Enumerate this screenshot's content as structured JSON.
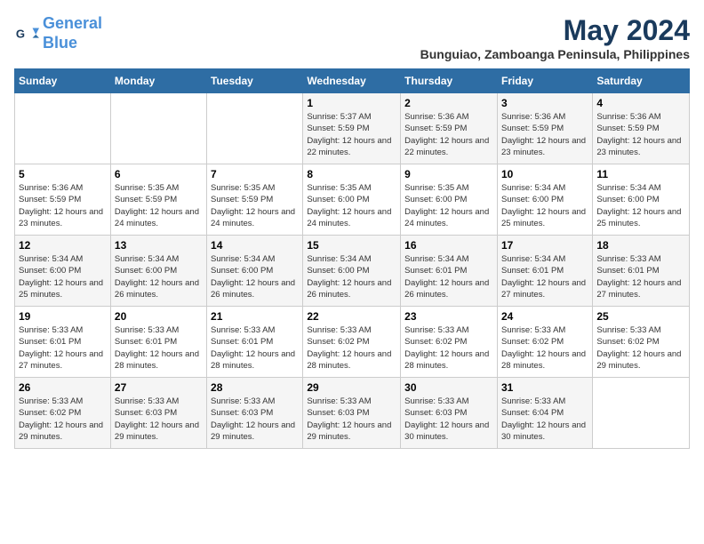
{
  "logo": {
    "line1": "General",
    "line2": "Blue"
  },
  "title": {
    "month_year": "May 2024",
    "location": "Bunguiao, Zamboanga Peninsula, Philippines"
  },
  "days_of_week": [
    "Sunday",
    "Monday",
    "Tuesday",
    "Wednesday",
    "Thursday",
    "Friday",
    "Saturday"
  ],
  "weeks": [
    {
      "days": [
        {
          "num": "",
          "sunrise": "",
          "sunset": "",
          "daylight": ""
        },
        {
          "num": "",
          "sunrise": "",
          "sunset": "",
          "daylight": ""
        },
        {
          "num": "",
          "sunrise": "",
          "sunset": "",
          "daylight": ""
        },
        {
          "num": "1",
          "sunrise": "Sunrise: 5:37 AM",
          "sunset": "Sunset: 5:59 PM",
          "daylight": "Daylight: 12 hours and 22 minutes."
        },
        {
          "num": "2",
          "sunrise": "Sunrise: 5:36 AM",
          "sunset": "Sunset: 5:59 PM",
          "daylight": "Daylight: 12 hours and 22 minutes."
        },
        {
          "num": "3",
          "sunrise": "Sunrise: 5:36 AM",
          "sunset": "Sunset: 5:59 PM",
          "daylight": "Daylight: 12 hours and 23 minutes."
        },
        {
          "num": "4",
          "sunrise": "Sunrise: 5:36 AM",
          "sunset": "Sunset: 5:59 PM",
          "daylight": "Daylight: 12 hours and 23 minutes."
        }
      ]
    },
    {
      "days": [
        {
          "num": "5",
          "sunrise": "Sunrise: 5:36 AM",
          "sunset": "Sunset: 5:59 PM",
          "daylight": "Daylight: 12 hours and 23 minutes."
        },
        {
          "num": "6",
          "sunrise": "Sunrise: 5:35 AM",
          "sunset": "Sunset: 5:59 PM",
          "daylight": "Daylight: 12 hours and 24 minutes."
        },
        {
          "num": "7",
          "sunrise": "Sunrise: 5:35 AM",
          "sunset": "Sunset: 5:59 PM",
          "daylight": "Daylight: 12 hours and 24 minutes."
        },
        {
          "num": "8",
          "sunrise": "Sunrise: 5:35 AM",
          "sunset": "Sunset: 6:00 PM",
          "daylight": "Daylight: 12 hours and 24 minutes."
        },
        {
          "num": "9",
          "sunrise": "Sunrise: 5:35 AM",
          "sunset": "Sunset: 6:00 PM",
          "daylight": "Daylight: 12 hours and 24 minutes."
        },
        {
          "num": "10",
          "sunrise": "Sunrise: 5:34 AM",
          "sunset": "Sunset: 6:00 PM",
          "daylight": "Daylight: 12 hours and 25 minutes."
        },
        {
          "num": "11",
          "sunrise": "Sunrise: 5:34 AM",
          "sunset": "Sunset: 6:00 PM",
          "daylight": "Daylight: 12 hours and 25 minutes."
        }
      ]
    },
    {
      "days": [
        {
          "num": "12",
          "sunrise": "Sunrise: 5:34 AM",
          "sunset": "Sunset: 6:00 PM",
          "daylight": "Daylight: 12 hours and 25 minutes."
        },
        {
          "num": "13",
          "sunrise": "Sunrise: 5:34 AM",
          "sunset": "Sunset: 6:00 PM",
          "daylight": "Daylight: 12 hours and 26 minutes."
        },
        {
          "num": "14",
          "sunrise": "Sunrise: 5:34 AM",
          "sunset": "Sunset: 6:00 PM",
          "daylight": "Daylight: 12 hours and 26 minutes."
        },
        {
          "num": "15",
          "sunrise": "Sunrise: 5:34 AM",
          "sunset": "Sunset: 6:00 PM",
          "daylight": "Daylight: 12 hours and 26 minutes."
        },
        {
          "num": "16",
          "sunrise": "Sunrise: 5:34 AM",
          "sunset": "Sunset: 6:01 PM",
          "daylight": "Daylight: 12 hours and 26 minutes."
        },
        {
          "num": "17",
          "sunrise": "Sunrise: 5:34 AM",
          "sunset": "Sunset: 6:01 PM",
          "daylight": "Daylight: 12 hours and 27 minutes."
        },
        {
          "num": "18",
          "sunrise": "Sunrise: 5:33 AM",
          "sunset": "Sunset: 6:01 PM",
          "daylight": "Daylight: 12 hours and 27 minutes."
        }
      ]
    },
    {
      "days": [
        {
          "num": "19",
          "sunrise": "Sunrise: 5:33 AM",
          "sunset": "Sunset: 6:01 PM",
          "daylight": "Daylight: 12 hours and 27 minutes."
        },
        {
          "num": "20",
          "sunrise": "Sunrise: 5:33 AM",
          "sunset": "Sunset: 6:01 PM",
          "daylight": "Daylight: 12 hours and 28 minutes."
        },
        {
          "num": "21",
          "sunrise": "Sunrise: 5:33 AM",
          "sunset": "Sunset: 6:01 PM",
          "daylight": "Daylight: 12 hours and 28 minutes."
        },
        {
          "num": "22",
          "sunrise": "Sunrise: 5:33 AM",
          "sunset": "Sunset: 6:02 PM",
          "daylight": "Daylight: 12 hours and 28 minutes."
        },
        {
          "num": "23",
          "sunrise": "Sunrise: 5:33 AM",
          "sunset": "Sunset: 6:02 PM",
          "daylight": "Daylight: 12 hours and 28 minutes."
        },
        {
          "num": "24",
          "sunrise": "Sunrise: 5:33 AM",
          "sunset": "Sunset: 6:02 PM",
          "daylight": "Daylight: 12 hours and 28 minutes."
        },
        {
          "num": "25",
          "sunrise": "Sunrise: 5:33 AM",
          "sunset": "Sunset: 6:02 PM",
          "daylight": "Daylight: 12 hours and 29 minutes."
        }
      ]
    },
    {
      "days": [
        {
          "num": "26",
          "sunrise": "Sunrise: 5:33 AM",
          "sunset": "Sunset: 6:02 PM",
          "daylight": "Daylight: 12 hours and 29 minutes."
        },
        {
          "num": "27",
          "sunrise": "Sunrise: 5:33 AM",
          "sunset": "Sunset: 6:03 PM",
          "daylight": "Daylight: 12 hours and 29 minutes."
        },
        {
          "num": "28",
          "sunrise": "Sunrise: 5:33 AM",
          "sunset": "Sunset: 6:03 PM",
          "daylight": "Daylight: 12 hours and 29 minutes."
        },
        {
          "num": "29",
          "sunrise": "Sunrise: 5:33 AM",
          "sunset": "Sunset: 6:03 PM",
          "daylight": "Daylight: 12 hours and 29 minutes."
        },
        {
          "num": "30",
          "sunrise": "Sunrise: 5:33 AM",
          "sunset": "Sunset: 6:03 PM",
          "daylight": "Daylight: 12 hours and 30 minutes."
        },
        {
          "num": "31",
          "sunrise": "Sunrise: 5:33 AM",
          "sunset": "Sunset: 6:04 PM",
          "daylight": "Daylight: 12 hours and 30 minutes."
        },
        {
          "num": "",
          "sunrise": "",
          "sunset": "",
          "daylight": ""
        }
      ]
    }
  ]
}
